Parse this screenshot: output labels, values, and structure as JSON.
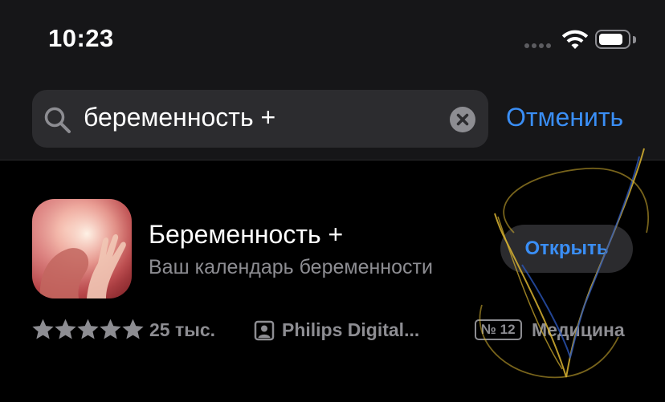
{
  "status_bar": {
    "time": "10:23",
    "battery_level": 0.85
  },
  "search": {
    "query": "беременность +",
    "cancel_label": "Отменить"
  },
  "result": {
    "app_name": "Беременность +",
    "subtitle": "Ваш календарь беременности",
    "open_label": "Открыть",
    "rating_stars": 5,
    "rating_count": "25 тыс.",
    "developer": "Philips Digital...",
    "rank": "№ 12",
    "category": "Медицина"
  },
  "colors": {
    "accent": "#3a8ef5",
    "secondary_text": "#8d8d92",
    "field_bg": "#2c2c2f",
    "header_bg": "#161618"
  },
  "icons": {
    "search": "search-icon",
    "clear": "clear-icon",
    "wifi": "wifi-icon",
    "battery": "battery-icon",
    "star": "star-icon",
    "developer": "person-icon"
  }
}
